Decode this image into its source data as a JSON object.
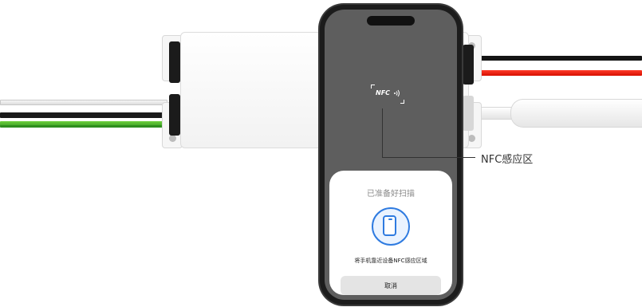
{
  "callout": {
    "label": "NFC感应区"
  },
  "nfc_tag": {
    "label": "NFC"
  },
  "sheet": {
    "title": "已准备好扫描",
    "hint": "将手机靠近设备NFC感应区域",
    "cancel_label": "取消"
  },
  "colors": {
    "accent": "#2f7be0",
    "wire_red": "#e81c0c",
    "wire_green": "#4bb52c",
    "wire_black": "#1a1a1a",
    "overlay": "#646464"
  }
}
